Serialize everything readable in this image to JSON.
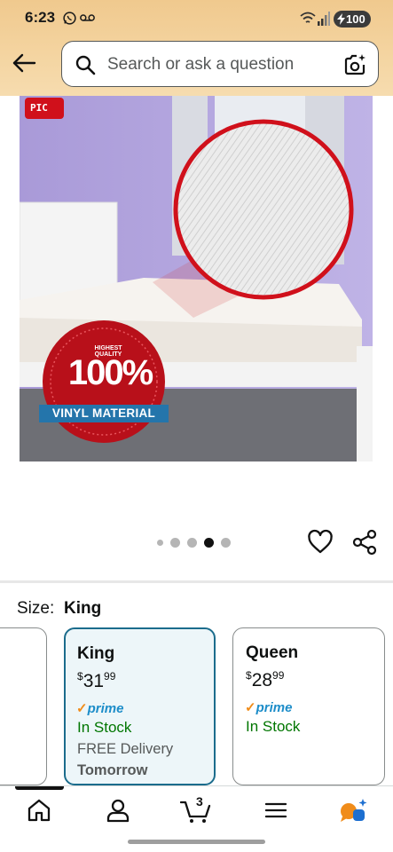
{
  "status_bar": {
    "time": "6:23",
    "battery": "100"
  },
  "header": {
    "search_placeholder": "Search or ask a question"
  },
  "product_image": {
    "brand_logo_text": "PIC",
    "badge_top": "HIGHEST QUALITY",
    "badge_percent": "100%",
    "badge_ribbon": "VINYL MATERIAL"
  },
  "carousel": {
    "dot_count": 5,
    "active_index": 3
  },
  "size": {
    "label": "Size:",
    "selected": "King",
    "options": [
      {
        "name": "King",
        "price_whole": "31",
        "price_cents": "99",
        "currency": "$",
        "prime": "prime",
        "stock": "In Stock",
        "delivery": "FREE Delivery",
        "delivery_day": "Tomorrow",
        "selected": true
      },
      {
        "name": "Queen",
        "price_whole": "28",
        "price_cents": "99",
        "currency": "$",
        "prime": "prime",
        "stock": "In Stock",
        "selected": false
      }
    ]
  },
  "bottom_nav": {
    "cart_count": "3",
    "items": [
      "home",
      "account",
      "cart",
      "menu",
      "rufus"
    ]
  },
  "colors": {
    "header_gradient": "#f0c98e",
    "prime_blue": "#1d8dc9",
    "in_stock": "#007600",
    "selected_border": "#1b6c8c",
    "badge_red": "#d0101b"
  }
}
